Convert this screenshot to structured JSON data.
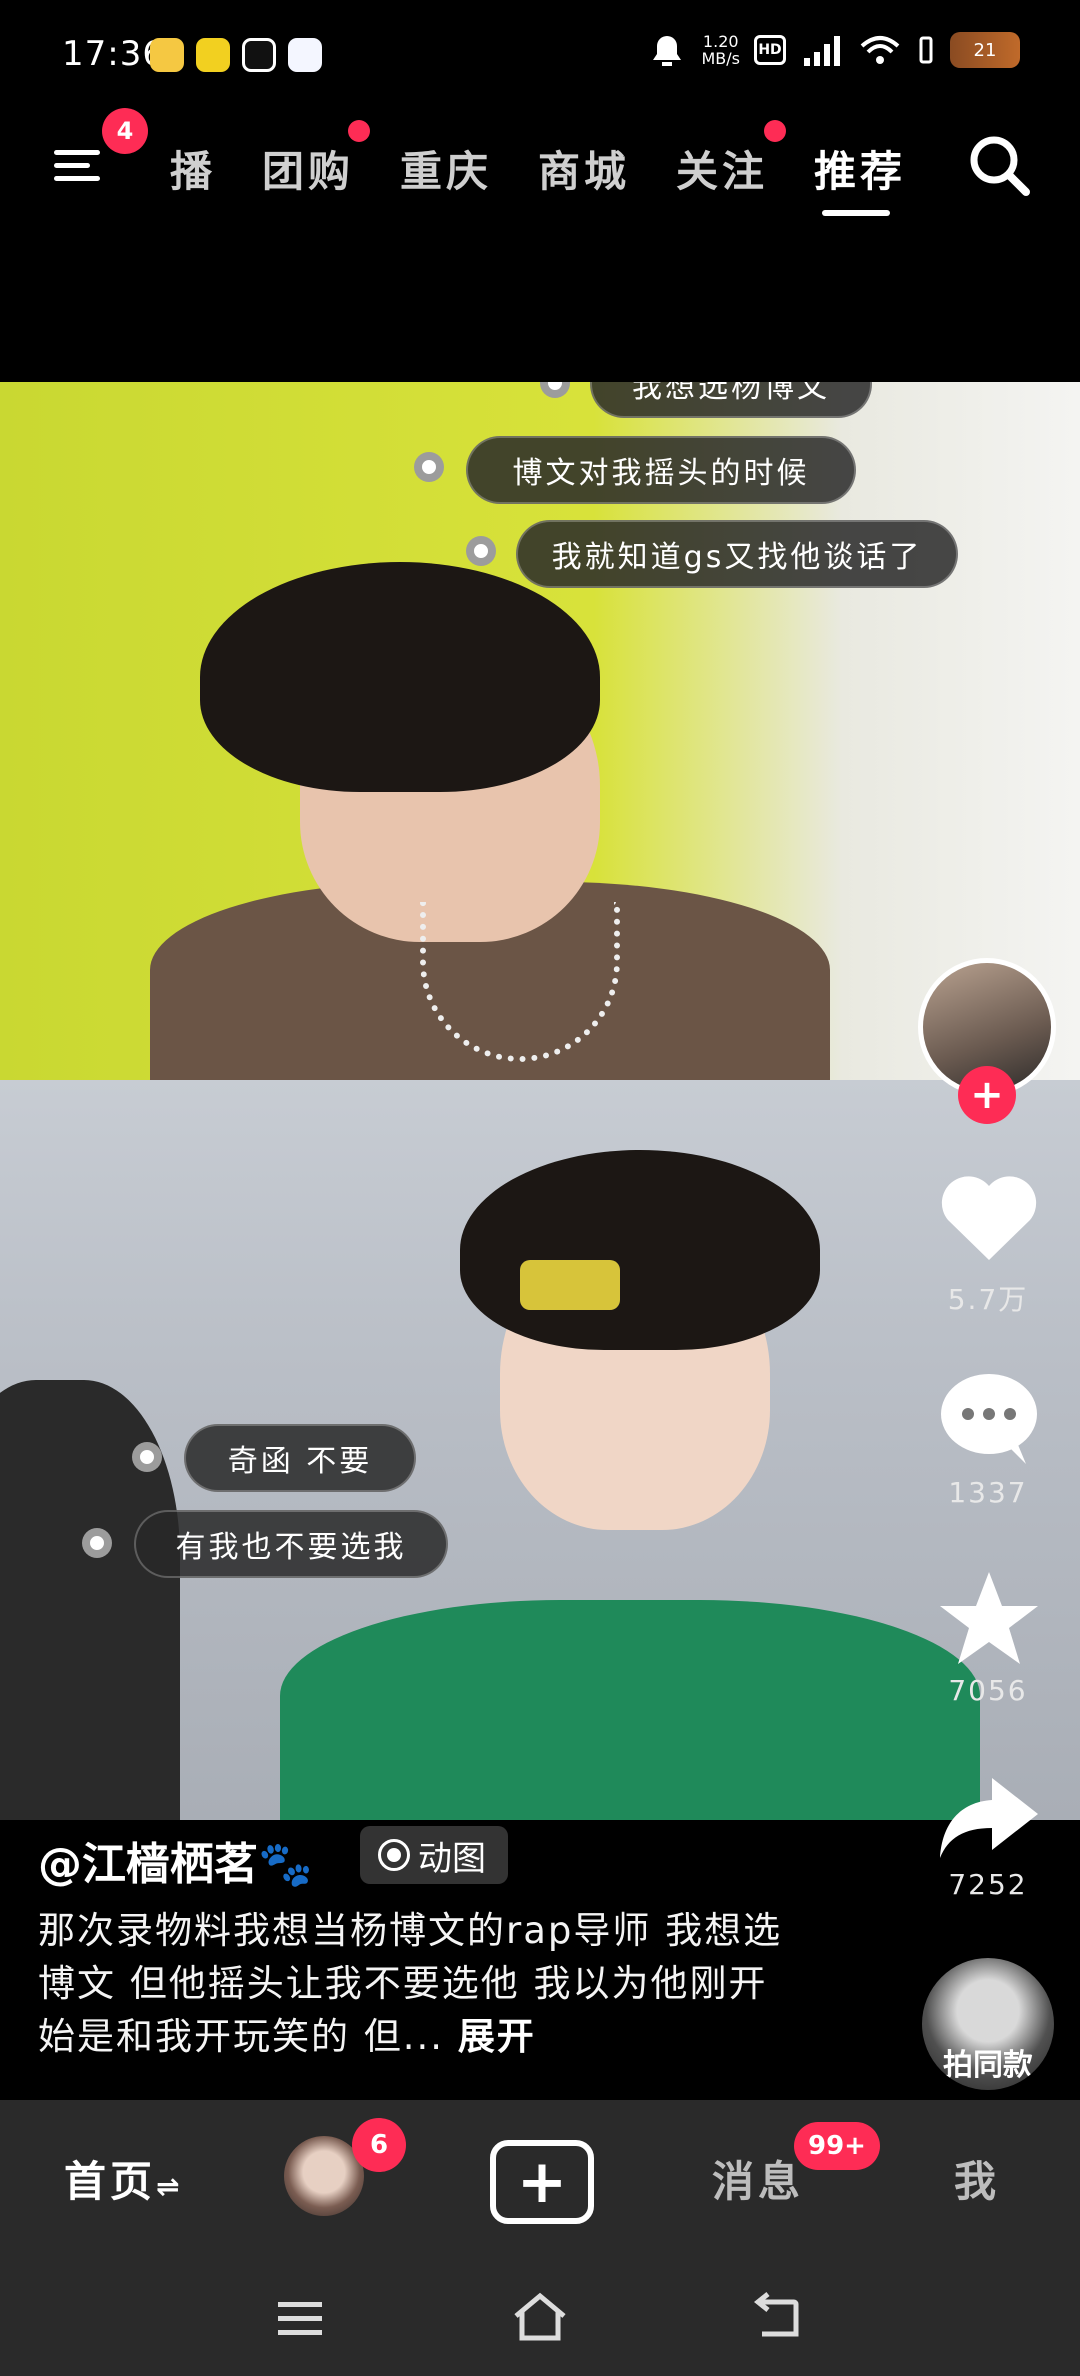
{
  "status_bar": {
    "time": "17:36",
    "net_speed_value": "1.20",
    "net_speed_unit": "MB/s",
    "hd_label": "HD",
    "battery_level": "21",
    "app_icon_names": [
      "weibo-icon",
      "app-icon-yellow",
      "app-icon-white",
      "app-icon-blue"
    ]
  },
  "top_nav": {
    "menu_badge": "4",
    "tabs": [
      {
        "label": "播",
        "has_dot": false,
        "active": false
      },
      {
        "label": "团购",
        "has_dot": true,
        "active": false
      },
      {
        "label": "重庆",
        "has_dot": false,
        "active": false
      },
      {
        "label": "商城",
        "has_dot": false,
        "active": false
      },
      {
        "label": "关注",
        "has_dot": true,
        "active": false
      },
      {
        "label": "推荐",
        "has_dot": false,
        "active": true
      }
    ],
    "accent_color": "#fe2c55"
  },
  "video": {
    "bubbles_top": [
      "我想选杨博文",
      "博文对我摇头的时候",
      "我就知道gs又找他谈话了"
    ],
    "bubbles_bottom": [
      "奇函 不要",
      "有我也不要选我"
    ]
  },
  "rail": {
    "follow_label": "+",
    "like_count": "5.7万",
    "comment_count": "1337",
    "favorite_count": "7056",
    "share_count": "7252",
    "same_style_label": "拍同款"
  },
  "caption": {
    "author": "@江樯栖茗🐾",
    "tag": "动图",
    "description": "那次录物料我想当杨博文的rap导师 我想选博文 但他摇头让我不要选他 我以为他刚开始是和我开玩笑的 但...",
    "expand_label": "展开"
  },
  "bottom_bar": {
    "home_label": "首页",
    "friend_badge": "6",
    "create_label": "+",
    "messages_label": "消息",
    "messages_badge": "99+",
    "me_label": "我"
  }
}
